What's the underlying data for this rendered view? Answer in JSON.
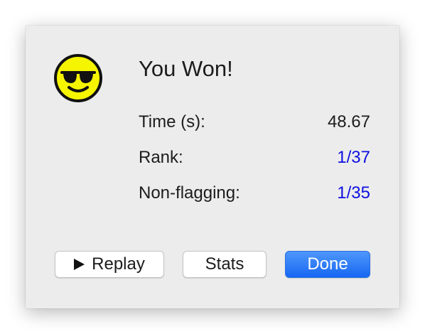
{
  "dialog": {
    "title": "You Won!",
    "icon": "sunglasses-smiley-icon",
    "stats": {
      "time_label": "Time (s):",
      "time_value": "48.67",
      "rank_label": "Rank:",
      "rank_value": "1/37",
      "nonflagging_label": "Non-flagging:",
      "nonflagging_value": "1/35"
    },
    "buttons": {
      "replay_icon": "play-icon",
      "replay_label": "Replay",
      "stats_label": "Stats",
      "done_label": "Done"
    }
  },
  "colors": {
    "dialog_background": "#ececec",
    "link_value": "#0f0fe0",
    "primary_button": "#1667f3",
    "smiley_face": "#f5f500"
  }
}
